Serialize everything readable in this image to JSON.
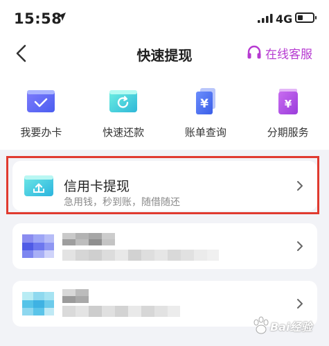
{
  "status_bar": {
    "time": "15:58",
    "network": "4G"
  },
  "nav": {
    "title": "快速提现",
    "service_label": "在线客服"
  },
  "quick_actions": [
    {
      "label": "我要办卡",
      "icon": "card-check-icon"
    },
    {
      "label": "快速还款",
      "icon": "refresh-card-icon"
    },
    {
      "label": "账单查询",
      "icon": "yen-bill-icon"
    },
    {
      "label": "分期服务",
      "icon": "yen-bag-icon"
    }
  ],
  "cards": [
    {
      "title": "信用卡提现",
      "subtitle": "急用钱，秒到账，随借随还",
      "icon": "upload-card-icon",
      "highlighted": true
    },
    {
      "title": "",
      "subtitle": "",
      "icon": "pixelated-icon",
      "obscured": true
    },
    {
      "title": "",
      "subtitle": "",
      "icon": "pixelated-icon",
      "obscured": true
    }
  ],
  "colors": {
    "accent_purple": "#b63ad1",
    "highlight_red": "#e03a2f",
    "page_background": "#f2f3f7"
  }
}
